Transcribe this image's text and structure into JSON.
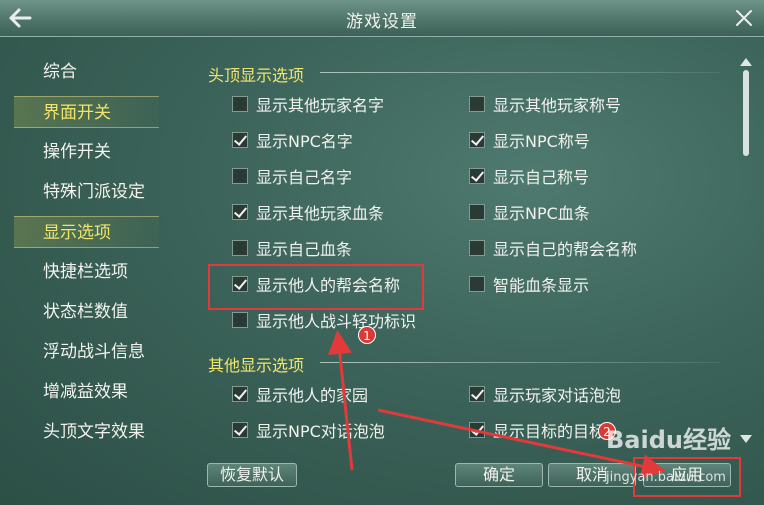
{
  "window": {
    "title": "游戏设置"
  },
  "sidebar": {
    "items": [
      {
        "label": "综合",
        "active": false
      },
      {
        "label": "界面开关",
        "active": true
      },
      {
        "label": "操作开关",
        "active": false
      },
      {
        "label": "特殊门派设定",
        "active": false
      },
      {
        "label": "显示选项",
        "active": true
      },
      {
        "label": "快捷栏选项",
        "active": false
      },
      {
        "label": "状态栏数值",
        "active": false
      },
      {
        "label": "浮动战斗信息",
        "active": false
      },
      {
        "label": "增减益效果",
        "active": false
      },
      {
        "label": "头顶文字效果",
        "active": false
      }
    ]
  },
  "head_section": {
    "title": "头顶显示选项",
    "options": [
      {
        "label": "显示其他玩家名字",
        "checked": false
      },
      {
        "label": "显示其他玩家称号",
        "checked": false
      },
      {
        "label": "显示NPC名字",
        "checked": true
      },
      {
        "label": "显示NPC称号",
        "checked": true
      },
      {
        "label": "显示自己名字",
        "checked": false
      },
      {
        "label": "显示自己称号",
        "checked": true
      },
      {
        "label": "显示其他玩家血条",
        "checked": true
      },
      {
        "label": "显示NPC血条",
        "checked": false
      },
      {
        "label": "显示自己血条",
        "checked": false
      },
      {
        "label": "显示自己的帮会名称",
        "checked": false
      },
      {
        "label": "显示他人的帮会名称",
        "checked": true
      },
      {
        "label": "智能血条显示",
        "checked": false
      },
      {
        "label": "显示他人战斗轻功标识",
        "checked": false
      }
    ]
  },
  "other_section": {
    "title": "其他显示选项",
    "options": [
      {
        "label": "显示他人的家园",
        "checked": true
      },
      {
        "label": "显示玩家对话泡泡",
        "checked": true
      },
      {
        "label": "显示NPC对话泡泡",
        "checked": true
      },
      {
        "label": "显示目标的目标",
        "checked": true
      }
    ]
  },
  "footer": {
    "restore_label": "恢复默认",
    "ok_label": "确定",
    "cancel_label": "取消",
    "apply_label": "应用"
  },
  "annotations": {
    "badge_1": "1",
    "badge_2": "2",
    "color": "#e23a3a"
  },
  "watermark": {
    "logo": "Baidu经验",
    "url": "jingyan.baidu.com"
  },
  "icons": [
    "back-arrow-icon",
    "close-icon",
    "checkmark-icon",
    "scroll-up-icon",
    "scroll-down-icon"
  ]
}
